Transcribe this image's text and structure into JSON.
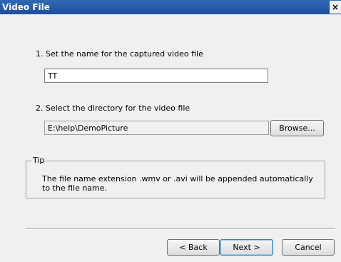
{
  "window": {
    "title": "Video File",
    "close_glyph": "×"
  },
  "step1": {
    "label": "1. Set the name for the captured video file",
    "value": "TT"
  },
  "step2": {
    "label": "2. Select the directory for the video file",
    "path": "E:\\help\\DemoPicture",
    "browse_label": "Browse..."
  },
  "tip": {
    "legend": "Tip",
    "text": "The file name extension .wmv or .avi will be appended automatically to the file name."
  },
  "buttons": {
    "back": "< Back",
    "next": "Next >",
    "cancel": "Cancel"
  }
}
